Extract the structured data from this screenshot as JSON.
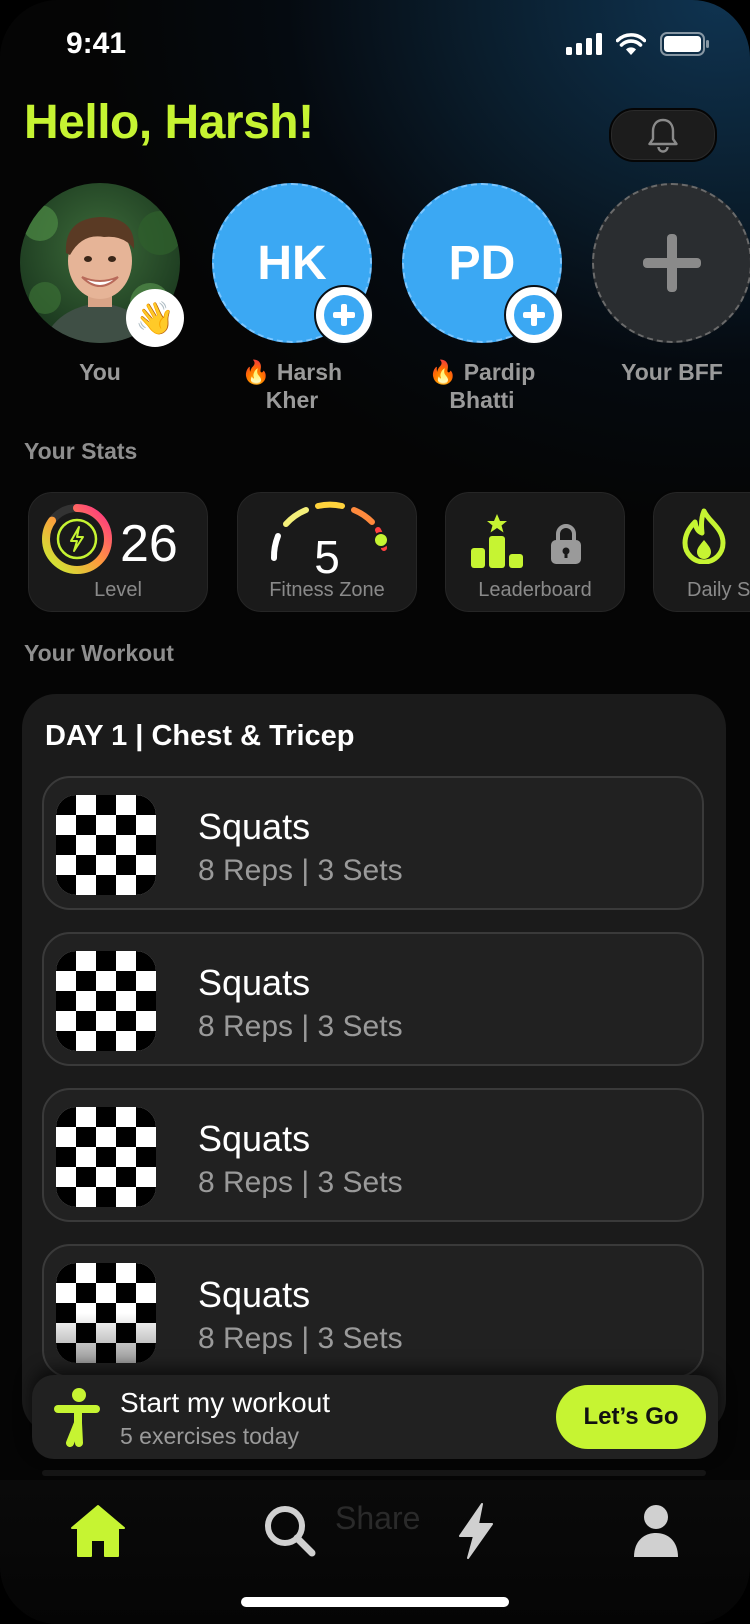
{
  "status_bar": {
    "time": "9:41"
  },
  "header": {
    "greeting": "Hello, Harsh!"
  },
  "friends": [
    {
      "name": "You",
      "badge_icon": "waving-hand-icon"
    },
    {
      "initials": "HK",
      "name_line1": "🔥 Harsh",
      "name_line2": "Kher"
    },
    {
      "initials": "PD",
      "name_line1": "🔥 Pardip",
      "name_line2": "Bhatti"
    },
    {
      "name": "Your BFF"
    }
  ],
  "stats": {
    "title": "Your Stats",
    "items": [
      {
        "value": "26",
        "label": "Level",
        "ring_progress": 0.85
      },
      {
        "value": "5",
        "label": "Fitness Zone"
      },
      {
        "label": "Leaderboard"
      },
      {
        "label": "Daily S"
      }
    ]
  },
  "workout": {
    "title": "Your Workout",
    "day": "DAY 1 | Chest & Tricep",
    "exercises": [
      {
        "name": "Squats",
        "meta": "8 Reps | 3 Sets"
      },
      {
        "name": "Squats",
        "meta": "8 Reps | 3 Sets"
      },
      {
        "name": "Squats",
        "meta": "8 Reps | 3 Sets"
      },
      {
        "name": "Squats",
        "meta": "8 Reps | 3 Sets"
      }
    ]
  },
  "start_bar": {
    "title": "Start my workout",
    "subtitle": "5 exercises today",
    "button": "Let’s Go"
  },
  "tab_bar": {
    "ghost_label": "Share"
  },
  "colors": {
    "accent": "#c6f432",
    "friend_blue": "#3ba8f3"
  }
}
